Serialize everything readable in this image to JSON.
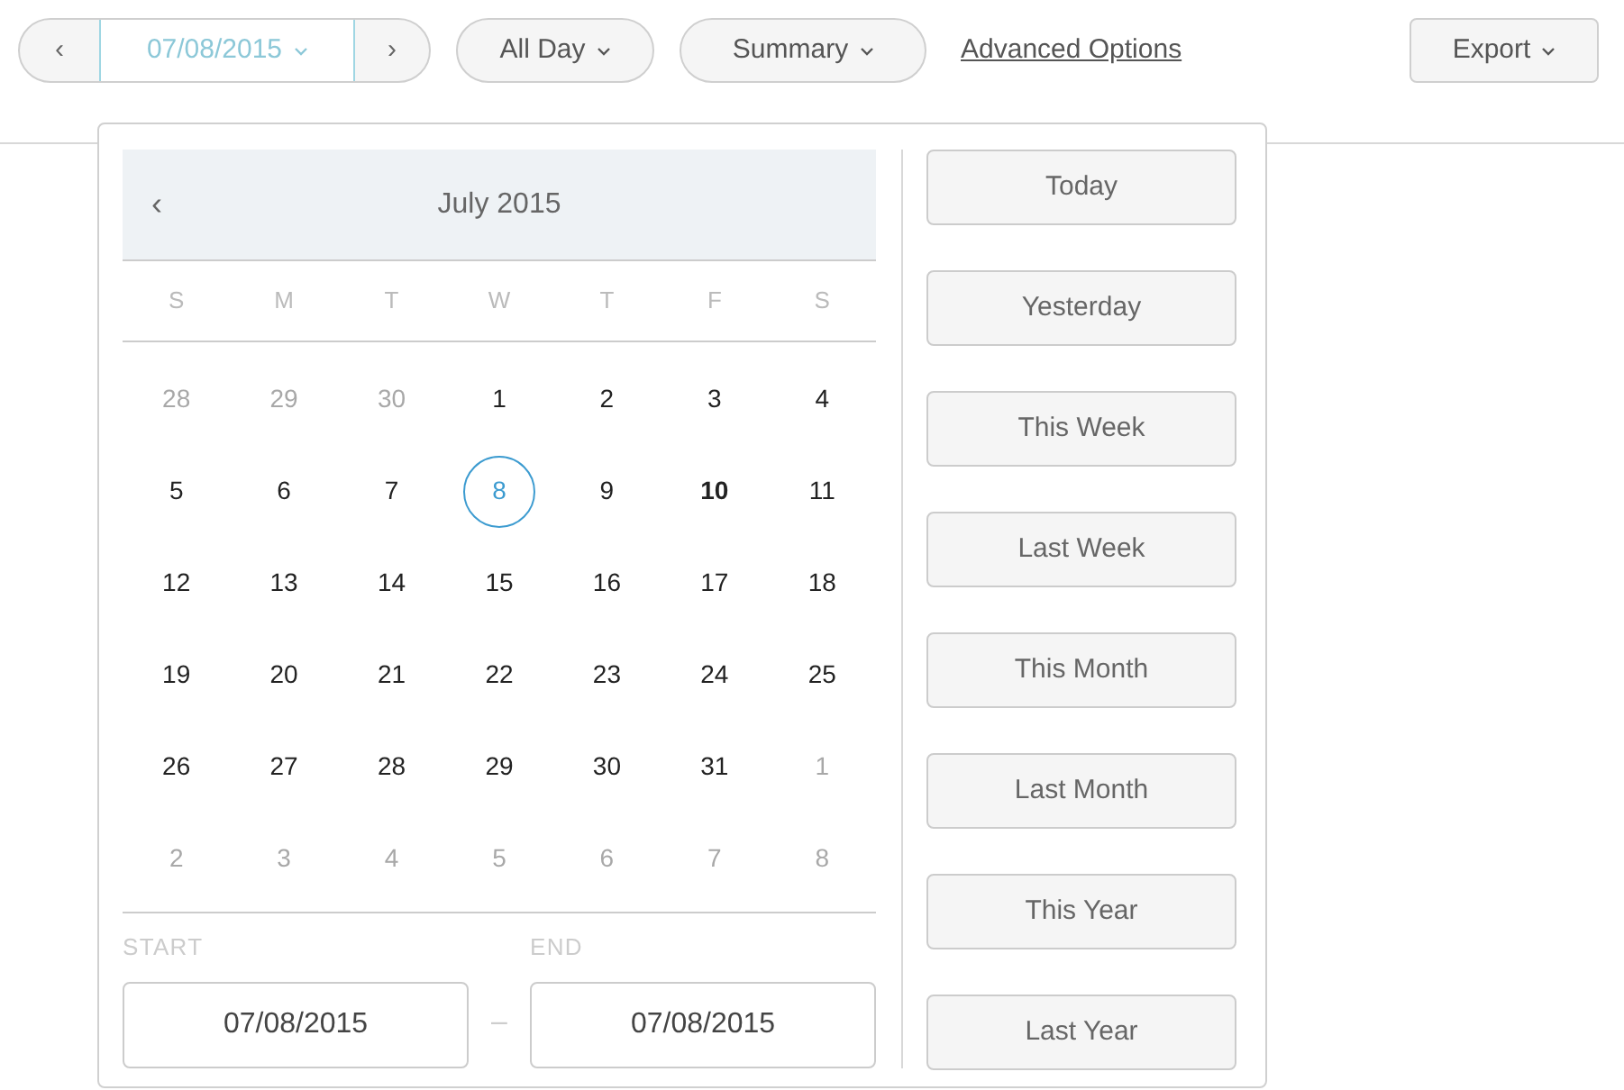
{
  "toolbar": {
    "prev": "‹",
    "date": "07/08/2015",
    "next": "›",
    "time_range": "All Day",
    "view": "Summary",
    "advanced_link": "Advanced Options",
    "export": "Export"
  },
  "calendar": {
    "prev": "‹",
    "month": "July 2015",
    "weekdays": [
      "S",
      "M",
      "T",
      "W",
      "T",
      "F",
      "S"
    ],
    "weeks": [
      [
        {
          "day": "28",
          "muted": true,
          "selected": false,
          "today": false
        },
        {
          "day": "29",
          "muted": true,
          "selected": false,
          "today": false
        },
        {
          "day": "30",
          "muted": true,
          "selected": false,
          "today": false
        },
        {
          "day": "1",
          "muted": false,
          "selected": false,
          "today": false
        },
        {
          "day": "2",
          "muted": false,
          "selected": false,
          "today": false
        },
        {
          "day": "3",
          "muted": false,
          "selected": false,
          "today": false
        },
        {
          "day": "4",
          "muted": false,
          "selected": false,
          "today": false
        }
      ],
      [
        {
          "day": "5",
          "muted": false,
          "selected": false,
          "today": false
        },
        {
          "day": "6",
          "muted": false,
          "selected": false,
          "today": false
        },
        {
          "day": "7",
          "muted": false,
          "selected": false,
          "today": false
        },
        {
          "day": "8",
          "muted": false,
          "selected": true,
          "today": false
        },
        {
          "day": "9",
          "muted": false,
          "selected": false,
          "today": false
        },
        {
          "day": "10",
          "muted": false,
          "selected": false,
          "today": true
        },
        {
          "day": "11",
          "muted": false,
          "selected": false,
          "today": false
        }
      ],
      [
        {
          "day": "12",
          "muted": false,
          "selected": false,
          "today": false
        },
        {
          "day": "13",
          "muted": false,
          "selected": false,
          "today": false
        },
        {
          "day": "14",
          "muted": false,
          "selected": false,
          "today": false
        },
        {
          "day": "15",
          "muted": false,
          "selected": false,
          "today": false
        },
        {
          "day": "16",
          "muted": false,
          "selected": false,
          "today": false
        },
        {
          "day": "17",
          "muted": false,
          "selected": false,
          "today": false
        },
        {
          "day": "18",
          "muted": false,
          "selected": false,
          "today": false
        }
      ],
      [
        {
          "day": "19",
          "muted": false,
          "selected": false,
          "today": false
        },
        {
          "day": "20",
          "muted": false,
          "selected": false,
          "today": false
        },
        {
          "day": "21",
          "muted": false,
          "selected": false,
          "today": false
        },
        {
          "day": "22",
          "muted": false,
          "selected": false,
          "today": false
        },
        {
          "day": "23",
          "muted": false,
          "selected": false,
          "today": false
        },
        {
          "day": "24",
          "muted": false,
          "selected": false,
          "today": false
        },
        {
          "day": "25",
          "muted": false,
          "selected": false,
          "today": false
        }
      ],
      [
        {
          "day": "26",
          "muted": false,
          "selected": false,
          "today": false
        },
        {
          "day": "27",
          "muted": false,
          "selected": false,
          "today": false
        },
        {
          "day": "28",
          "muted": false,
          "selected": false,
          "today": false
        },
        {
          "day": "29",
          "muted": false,
          "selected": false,
          "today": false
        },
        {
          "day": "30",
          "muted": false,
          "selected": false,
          "today": false
        },
        {
          "day": "31",
          "muted": false,
          "selected": false,
          "today": false
        },
        {
          "day": "1",
          "muted": true,
          "selected": false,
          "today": false
        }
      ],
      [
        {
          "day": "2",
          "muted": true,
          "selected": false,
          "today": false
        },
        {
          "day": "3",
          "muted": true,
          "selected": false,
          "today": false
        },
        {
          "day": "4",
          "muted": true,
          "selected": false,
          "today": false
        },
        {
          "day": "5",
          "muted": true,
          "selected": false,
          "today": false
        },
        {
          "day": "6",
          "muted": true,
          "selected": false,
          "today": false
        },
        {
          "day": "7",
          "muted": true,
          "selected": false,
          "today": false
        },
        {
          "day": "8",
          "muted": true,
          "selected": false,
          "today": false
        }
      ]
    ],
    "start_label": "START",
    "start_value": "07/08/2015",
    "separator": "–",
    "end_label": "END",
    "end_value": "07/08/2015"
  },
  "presets": [
    "Today",
    "Yesterday",
    "This Week",
    "Last Week",
    "This Month",
    "Last Month",
    "This Year",
    "Last Year"
  ]
}
